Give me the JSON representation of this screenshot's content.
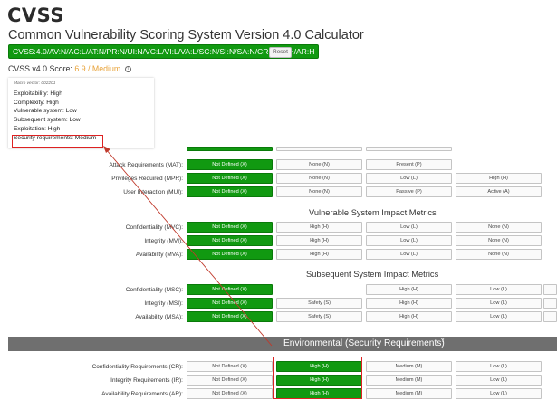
{
  "header": {
    "logo_text": "CVSS",
    "title": "Common Vulnerability Scoring System Version 4.0 Calculator",
    "vector_string": "CVSS:4.0/AV:N/AC:L/AT:N/PR:N/UI:N/VC:L/VI:L/VA:L/SC:N/SI:N/SA:N/CR:H/IR:H/AR:H",
    "reset_label": "Reset",
    "score_label": "CVSS v4.0 Score:",
    "score_value": "6.9 / Medium"
  },
  "tooltip": {
    "macro_vector": "Macro vector: 002201",
    "lines": [
      "Exploitability: High",
      "Complexity: High",
      "Vulnerable system: Low",
      "Subsequent system: Low",
      "Exploitation: High",
      "Security requirements: Medium"
    ]
  },
  "exploitability_rows": [
    {
      "label": "Attack Requirements (MAT):",
      "options": [
        "Not Defined (X)",
        "None (N)",
        "Present (P)"
      ],
      "selected": 0
    },
    {
      "label": "Privileges Required (MPR):",
      "options": [
        "Not Defined (X)",
        "None (N)",
        "Low (L)",
        "High (H)"
      ],
      "selected": 0
    },
    {
      "label": "User Interaction (MUI):",
      "options": [
        "Not Defined (X)",
        "None (N)",
        "Passive (P)",
        "Active (A)"
      ],
      "selected": 0
    }
  ],
  "vulnerable_heading": "Vulnerable System Impact Metrics",
  "vulnerable_rows": [
    {
      "label": "Confidentiality (MVC):",
      "options": [
        "Not Defined (X)",
        "High (H)",
        "Low (L)",
        "None (N)"
      ],
      "selected": 0
    },
    {
      "label": "Integrity (MVI):",
      "options": [
        "Not Defined (X)",
        "High (H)",
        "Low (L)",
        "None (N)"
      ],
      "selected": 0
    },
    {
      "label": "Availability (MVA):",
      "options": [
        "Not Defined (X)",
        "High (H)",
        "Low (L)",
        "None (N)"
      ],
      "selected": 0
    }
  ],
  "subsequent_heading": "Subsequent System Impact Metrics",
  "subsequent_rows": [
    {
      "label": "Confidentiality (MSC):",
      "options": [
        "Not Defined (X)",
        "",
        "High (H)",
        "Low (L)",
        ""
      ],
      "selected": 0
    },
    {
      "label": "Integrity (MSI):",
      "options": [
        "Not Defined (X)",
        "Safety (S)",
        "High (H)",
        "Low (L)",
        ""
      ],
      "selected": 0
    },
    {
      "label": "Availability (MSA):",
      "options": [
        "Not Defined (X)",
        "Safety (S)",
        "High (H)",
        "Low (L)",
        ""
      ],
      "selected": 0
    }
  ],
  "environmental": {
    "title": "Environmental (Security Requirements)",
    "help_marker": "?",
    "rows": [
      {
        "label": "Confidentiality Requirements (CR):",
        "options": [
          "Not Defined (X)",
          "High (H)",
          "Medium (M)",
          "Low (L)"
        ],
        "selected": 1
      },
      {
        "label": "Integrity Requirements (IR):",
        "options": [
          "Not Defined (X)",
          "High (H)",
          "Medium (M)",
          "Low (L)"
        ],
        "selected": 1
      },
      {
        "label": "Availability Requirements (AR):",
        "options": [
          "Not Defined (X)",
          "High (H)",
          "Medium (M)",
          "Low (L)"
        ],
        "selected": 1
      }
    ]
  },
  "colors": {
    "selected_green": "#119911",
    "score_orange": "#e8a33a",
    "highlight_red": "#dd2222",
    "section_bar": "#6f6f6f"
  }
}
